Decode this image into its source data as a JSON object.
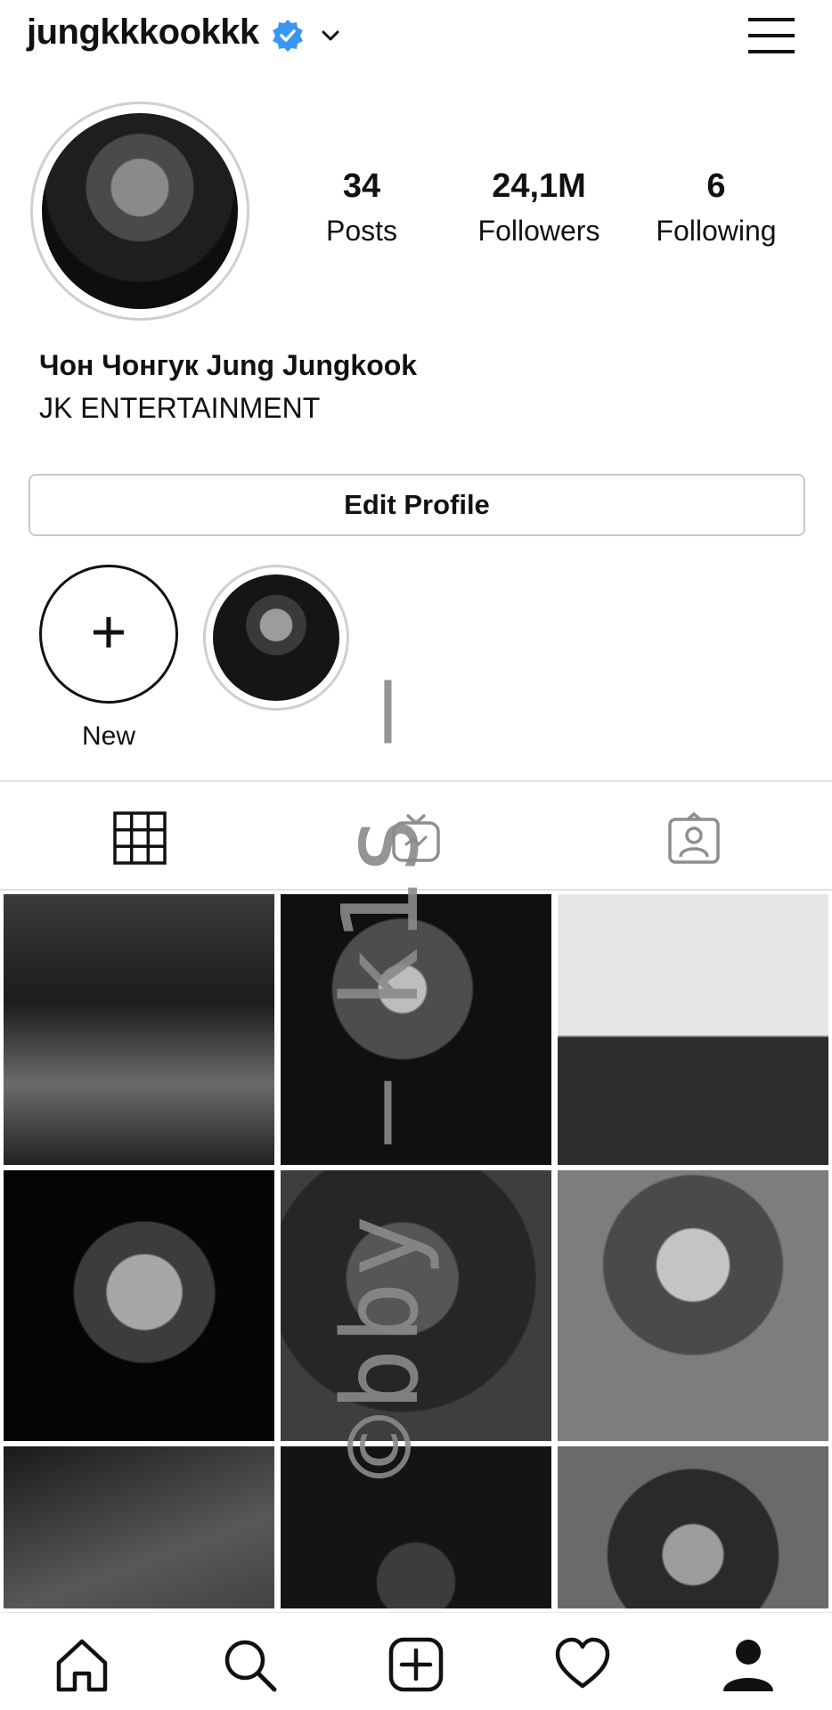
{
  "header": {
    "username": "jungkkkookkk",
    "icons": {
      "verified": "verified-badge-icon",
      "chevron": "chevron-down-icon",
      "menu": "hamburger-menu-icon"
    },
    "accent_color": "#3897f0"
  },
  "profile": {
    "stats": [
      {
        "value": "34",
        "label": "Posts"
      },
      {
        "value": "24,1M",
        "label": "Followers"
      },
      {
        "value": "6",
        "label": "Following"
      }
    ],
    "full_name": "Чон Чонгук Jung Jungkook",
    "bio": "JK ENTERTAINMENT",
    "edit_button": "Edit Profile"
  },
  "highlights": [
    {
      "label": "New",
      "icon": "plus-icon"
    },
    {
      "label": "",
      "icon": "highlight-photo"
    }
  ],
  "tabs": [
    {
      "icon": "grid-icon",
      "active": true
    },
    {
      "icon": "igtv-icon",
      "active": false
    },
    {
      "icon": "tagged-icon",
      "active": false
    }
  ],
  "posts_grid": {
    "rows": 3,
    "columns": 3,
    "visible_tiles": 9,
    "style": "grayscale photos"
  },
  "bottom_nav": [
    {
      "icon": "home-icon"
    },
    {
      "icon": "search-icon"
    },
    {
      "icon": "add-post-icon"
    },
    {
      "icon": "heart-icon"
    },
    {
      "icon": "profile-icon"
    }
  ],
  "watermark": {
    "text": "©bby — k1s —"
  }
}
